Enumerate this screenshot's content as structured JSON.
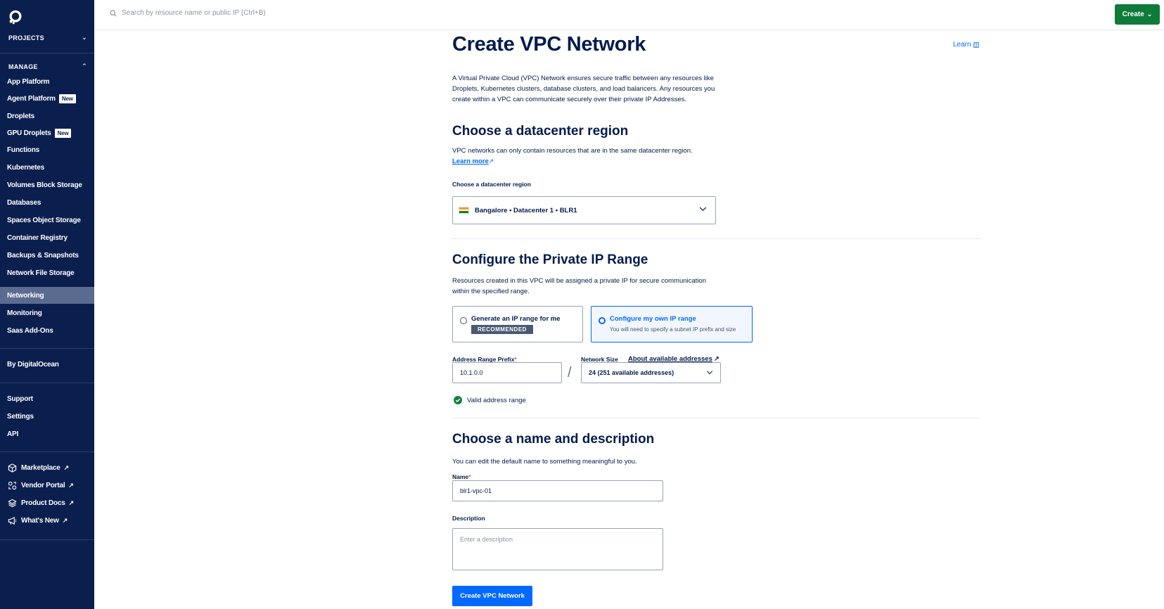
{
  "sidebar": {
    "projects_label": "PROJECTS",
    "manage_label": "MANAGE",
    "manage_items": [
      {
        "label": "App Platform"
      },
      {
        "label": "Agent Platform",
        "badge": "New"
      },
      {
        "label": "Droplets"
      },
      {
        "label": "GPU Droplets",
        "badge": "New"
      },
      {
        "label": "Functions"
      },
      {
        "label": "Kubernetes"
      },
      {
        "label": "Volumes Block Storage"
      },
      {
        "label": "Databases"
      },
      {
        "label": "Spaces Object Storage"
      },
      {
        "label": "Container Registry"
      },
      {
        "label": "Backups & Snapshots"
      },
      {
        "label": "Network File Storage"
      },
      {
        "label": "Networking"
      },
      {
        "label": "Monitoring"
      },
      {
        "label": "Saas Add-Ons"
      }
    ],
    "by_do": "By DigitalOcean",
    "support_items": [
      "Support",
      "Settings",
      "API"
    ],
    "external_items": [
      "Marketplace",
      "Vendor Portal",
      "Product Docs",
      "What's New"
    ]
  },
  "topbar": {
    "search_placeholder": "Search by resource name or public IP (Ctrl+B)",
    "create_label": "Create"
  },
  "main": {
    "title": "Create VPC Network",
    "learn_label": "Learn",
    "intro": "A Virtual Private Cloud (VPC) Network ensures secure traffic between any resources like Droplets, Kubernetes clusters, database clusters, and load balancers. Any resources you create within a VPC can communicate securely over their private IP Addresses.",
    "region": {
      "heading": "Choose a datacenter region",
      "desc": "VPC networks can only contain resources that are in the same datacenter region.",
      "learn_more": "Learn more",
      "field_label": "Choose a datacenter region",
      "selected": "Bangalore • Datacenter 1 • BLR1"
    },
    "ip_range": {
      "heading": "Configure the Private IP Range",
      "desc": "Resources created in this VPC will be assigned a private IP for secure communication within the specified range.",
      "option_generate": "Generate an IP range for me",
      "option_generate_badge": "RECOMMENDED",
      "option_configure": "Configure my own IP range",
      "option_configure_sub": "You will need to specify a subnet IP prefix and size",
      "prefix_label": "Address Range Prefix",
      "prefix_value": "10.1.0.0",
      "size_label": "Network Size",
      "about_link": "About available addresses",
      "size_value": "24 (251 available addresses)",
      "slash": "/",
      "valid_text": "Valid address range"
    },
    "name_section": {
      "heading": "Choose a name and description",
      "desc": "You can edit the default name to something meaningful to you.",
      "name_label": "Name",
      "name_value": "blr1-vpc-01",
      "desc_label": "Description",
      "desc_placeholder": "Enter a description"
    },
    "submit_label": "Create VPC Network"
  }
}
